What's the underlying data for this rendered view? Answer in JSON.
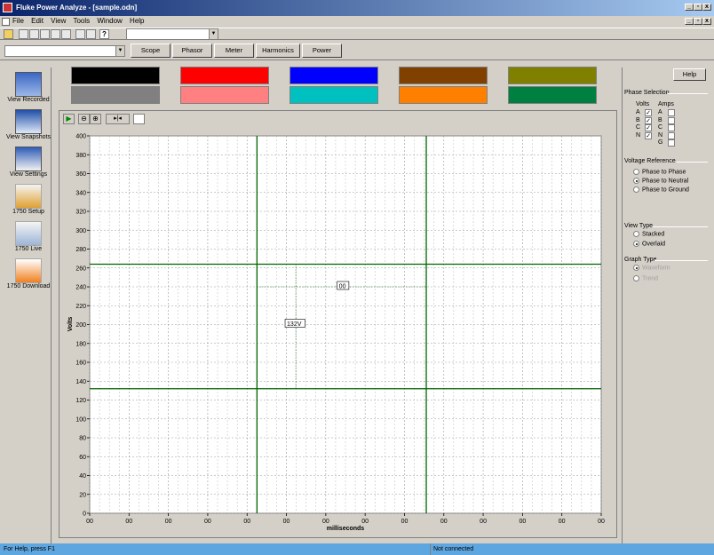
{
  "window": {
    "title": "Fluke Power Analyze - [sample.odn]"
  },
  "menu": [
    "File",
    "Edit",
    "View",
    "Tools",
    "Window",
    "Help"
  ],
  "tabs": [
    "Scope",
    "Phasor",
    "Meter",
    "Harmonics",
    "Power"
  ],
  "nav": [
    "View Recorded",
    "View Snapshots",
    "View Settings",
    "1750 Setup",
    "1750 Live",
    "1750 Download"
  ],
  "swatches": {
    "top": [
      "#000000",
      "#ff0000",
      "#0000ff",
      "#804000",
      "#808000"
    ],
    "bottom": [
      "#808080",
      "#ff8080",
      "#00c0c0",
      "#ff8000",
      "#008040"
    ]
  },
  "help_label": "Help",
  "phase": {
    "title": "Phase Selection",
    "volts_label": "Volts",
    "amps_label": "Amps",
    "volts": [
      {
        "label": "A",
        "checked": true
      },
      {
        "label": "B",
        "checked": true
      },
      {
        "label": "C",
        "checked": true
      },
      {
        "label": "N",
        "checked": true
      }
    ],
    "amps": [
      {
        "label": "A",
        "checked": false
      },
      {
        "label": "B",
        "checked": false
      },
      {
        "label": "C",
        "checked": false
      },
      {
        "label": "N",
        "checked": false
      },
      {
        "label": "G",
        "checked": false
      }
    ]
  },
  "voltage_ref": {
    "title": "Voltage Reference",
    "options": [
      "Phase to Phase",
      "Phase to Neutral",
      "Phase to Ground"
    ],
    "selected": 1
  },
  "view_type": {
    "title": "View Type",
    "options": [
      "Stacked",
      "Overlaid"
    ],
    "selected": 1
  },
  "graph_type": {
    "title": "Graph Type",
    "options": [
      "Waveform",
      "Trend"
    ],
    "selected": 0
  },
  "status": {
    "left": "For Help, press F1",
    "right": "Not connected"
  },
  "chart_data": {
    "type": "line",
    "xlabel": "milliseconds",
    "ylabel": "Volts",
    "ylim": [
      0,
      400
    ],
    "yticks": [
      0,
      20,
      40,
      60,
      80,
      100,
      120,
      140,
      160,
      180,
      200,
      220,
      240,
      260,
      280,
      300,
      320,
      340,
      360,
      380,
      400
    ],
    "xticks": [
      "00",
      "00",
      "00",
      "00",
      "00",
      "00",
      "00",
      "00",
      "00",
      "00",
      "00",
      "00",
      "00",
      "00"
    ],
    "grid": true,
    "cursors": {
      "horizontal": [
        264,
        132
      ],
      "vertical": [
        7,
        14
      ]
    },
    "annotations": [
      {
        "text": "00"
      },
      {
        "text": "132V"
      }
    ]
  },
  "colors": {
    "cursor": "#006400",
    "plot_bg": "#ffffff"
  }
}
